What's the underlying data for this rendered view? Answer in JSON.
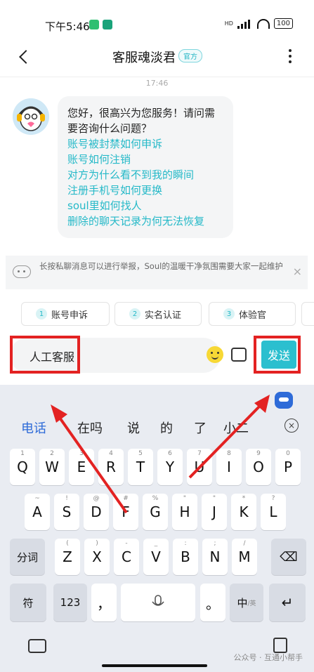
{
  "status_bar": {
    "time": "下午5:46",
    "battery": "100",
    "network": "HD"
  },
  "header": {
    "title": "客服魂淡君",
    "badge": "官方"
  },
  "chat": {
    "timestamp": "17:46",
    "greeting": "您好，很高兴为您服务！请问需要咨询什么问题？",
    "questions": [
      "账号被封禁如何申诉",
      "账号如何注销",
      "对方为什么看不到我的瞬间",
      "注册手机号如何更换",
      "soul里如何找人",
      "删除的聊天记录为何无法恢复"
    ]
  },
  "notice": {
    "text": "长按私聊消息可以进行举报，Soul的温暖干净氛围需要大家一起维护",
    "close": "×"
  },
  "quick_replies": [
    {
      "num": "1",
      "label": "账号申诉"
    },
    {
      "num": "2",
      "label": "实名认证"
    },
    {
      "num": "3",
      "label": "体验官"
    }
  ],
  "input": {
    "value": "人工客服",
    "send_label": "发送"
  },
  "keyboard": {
    "candidates": [
      "电话",
      "在吗",
      "说",
      "的",
      "了",
      "小二"
    ],
    "cand_close": "×",
    "row1": [
      {
        "k": "Q",
        "s": "1"
      },
      {
        "k": "W",
        "s": "2"
      },
      {
        "k": "E",
        "s": "3"
      },
      {
        "k": "R",
        "s": "4"
      },
      {
        "k": "T",
        "s": "5"
      },
      {
        "k": "Y",
        "s": "6"
      },
      {
        "k": "U",
        "s": "7"
      },
      {
        "k": "I",
        "s": "8"
      },
      {
        "k": "O",
        "s": "9"
      },
      {
        "k": "P",
        "s": "0"
      }
    ],
    "row2": [
      {
        "k": "A",
        "s": "~"
      },
      {
        "k": "S",
        "s": "!"
      },
      {
        "k": "D",
        "s": "@"
      },
      {
        "k": "F",
        "s": "#"
      },
      {
        "k": "G",
        "s": "%"
      },
      {
        "k": "H",
        "s": "\""
      },
      {
        "k": "J",
        "s": "\""
      },
      {
        "k": "K",
        "s": "*"
      },
      {
        "k": "L",
        "s": "?"
      }
    ],
    "row3": [
      {
        "k": "Z",
        "s": "("
      },
      {
        "k": "X",
        "s": ")"
      },
      {
        "k": "C",
        "s": "-"
      },
      {
        "k": "V",
        "s": "_"
      },
      {
        "k": "B",
        "s": ":"
      },
      {
        "k": "N",
        "s": ";"
      },
      {
        "k": "M",
        "s": "/"
      }
    ],
    "fenci": "分词",
    "fu": "符",
    "num_key": "123",
    "comma": "，",
    "period": "。",
    "lang": "中",
    "lang_sub": "/英",
    "backspace": "⌫",
    "enter": "↵"
  },
  "watermark": "公众号 · 互通小帮手",
  "colors": {
    "accent": "#2bbfcf",
    "highlight": "#e32222",
    "kb_blue": "#2e6bd8"
  }
}
